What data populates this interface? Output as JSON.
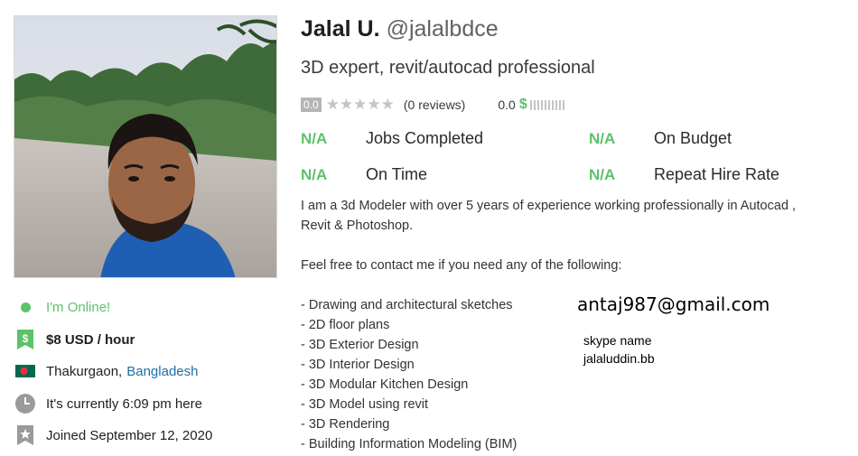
{
  "profile": {
    "name": "Jalal U.",
    "username": "@jalalbdce",
    "tagline": "3D expert, revit/autocad professional",
    "rating": "0.0",
    "stars": "★★★★★",
    "reviews": "(0 reviews)",
    "earnings_score": "0.0",
    "earnings_symbol": "$"
  },
  "stats": [
    {
      "value": "N/A",
      "label": "Jobs Completed"
    },
    {
      "value": "N/A",
      "label": "On Budget"
    },
    {
      "value": "N/A",
      "label": "On Time"
    },
    {
      "value": "N/A",
      "label": "Repeat Hire Rate"
    }
  ],
  "sidebar": {
    "online": "I'm Online!",
    "rate_icon": "$",
    "rate": "$8 USD / hour",
    "city": "Thakurgaon,",
    "country": "Bangladesh",
    "local_time": "It's currently 6:09 pm here",
    "joined": "Joined September 12, 2020"
  },
  "description": {
    "lines": [
      "I am a 3d Modeler with over 5 years of experience working professionally in Autocad ,",
      "Revit & Photoshop.",
      "Feel free to contact me if you need any of the following:",
      "- Drawing and architectural sketches",
      "- 2D floor plans",
      "- 3D Exterior Design",
      "- 3D Interior Design",
      "- 3D Modular Kitchen Design",
      "- 3D Model using revit",
      "- 3D Rendering",
      "- Building Information Modeling (BIM)"
    ]
  },
  "contact": {
    "email": "antaj987@gmail.com",
    "skype_label": "skype name",
    "skype_name": "jalaluddin.bb"
  },
  "colors": {
    "accent_green": "#5dc26a",
    "link_blue": "#1d6fa5",
    "flag_green": "#006a4e",
    "flag_red": "#f42a41"
  },
  "icons": [
    "online-dot-icon",
    "dollar-tag-icon",
    "bangladesh-flag-icon",
    "clock-icon",
    "badge-icon",
    "star-icon"
  ]
}
